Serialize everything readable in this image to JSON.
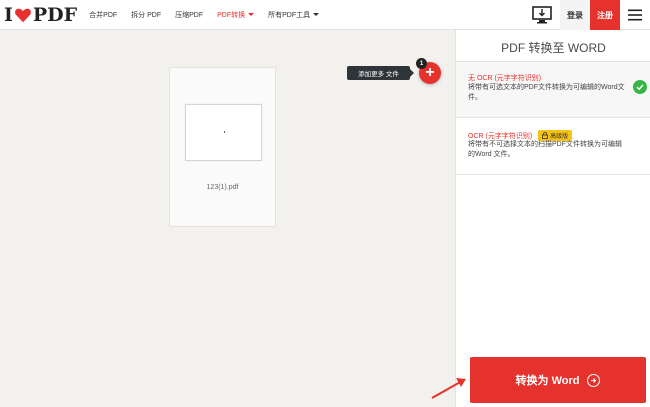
{
  "brand": {
    "logo_left": "I",
    "logo_right": "PDF"
  },
  "nav": {
    "items": [
      {
        "label": "合并PDF"
      },
      {
        "label": "拆分 PDF"
      },
      {
        "label": "压缩PDF"
      },
      {
        "label": "PDF转换"
      },
      {
        "label": "所有PDF工具"
      }
    ]
  },
  "header": {
    "login": "登录",
    "register": "注册"
  },
  "workspace": {
    "file_name": "123(1).pdf",
    "add_tooltip": "添加更多 文件",
    "file_count": "1"
  },
  "sidebar": {
    "title": "PDF 转换至 WORD",
    "options": [
      {
        "title": "无 OCR (元字字符识别)",
        "desc": "将带有可选文本的PDF文件转换为可编辑的Word文件。",
        "selected": true
      },
      {
        "title": "OCR (元字字符识别)",
        "badge": "高级版",
        "desc": "将带有不可选择文本的扫描PDF文件转换为可编辑的Word 文件。",
        "selected": false
      }
    ],
    "convert_label": "转换为 Word"
  },
  "colors": {
    "accent": "#e5322d",
    "success": "#38b449",
    "premium": "#f6c213"
  },
  "icons": {
    "add": "plus-icon",
    "desktop": "desktop-download-icon",
    "menu": "hamburger-icon",
    "check": "check-icon",
    "lock": "lock-icon",
    "convert": "arrow-right-circle-icon"
  }
}
